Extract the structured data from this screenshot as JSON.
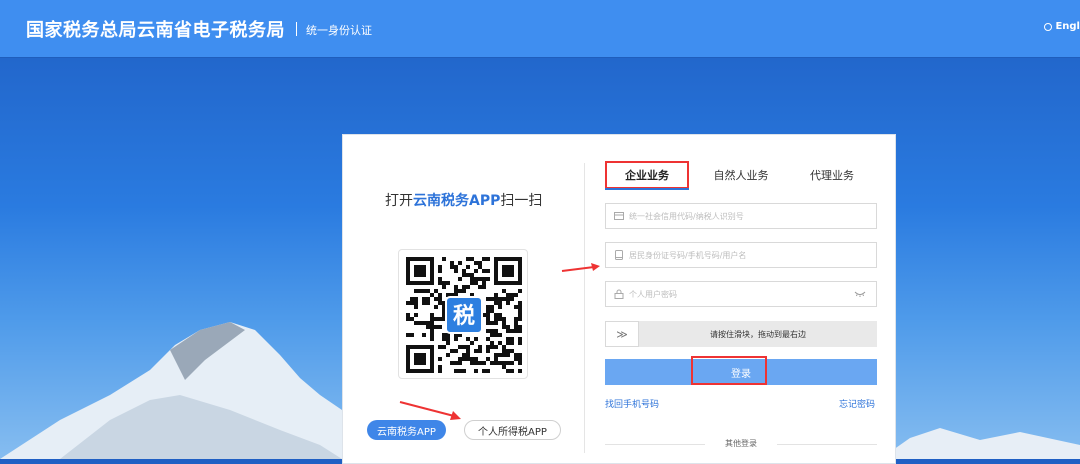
{
  "header": {
    "title": "国家税务总局云南省电子税务局",
    "subtitle": "统一身份认证",
    "language": "Engl"
  },
  "qr_panel": {
    "title_prefix": "打开",
    "title_app": "云南税务APP",
    "title_suffix": "扫一扫",
    "logo_char": "税",
    "buttons": [
      {
        "label": "云南税务APP",
        "active": true
      },
      {
        "label": "个人所得税APP",
        "active": false
      }
    ]
  },
  "tabs": [
    {
      "label": "企业业务",
      "active": true
    },
    {
      "label": "自然人业务",
      "active": false
    },
    {
      "label": "代理业务",
      "active": false
    }
  ],
  "form": {
    "credit_code_placeholder": "统一社会信用代码/纳税人识别号",
    "account_placeholder": "居民身份证号码/手机号码/用户名",
    "password_placeholder": "个人用户密码",
    "slider_text": "请按住滑块，拖动到最右边",
    "slider_handle": "≫",
    "login_label": "登录",
    "retrieve_phone": "找回手机号码",
    "forgot_password": "忘记密码",
    "other_login": "其他登录"
  },
  "colors": {
    "header_bg": "#3f8ef0",
    "accent": "#2d73d9",
    "login_button": "#6aa7f2",
    "highlight": "#ee3333"
  }
}
